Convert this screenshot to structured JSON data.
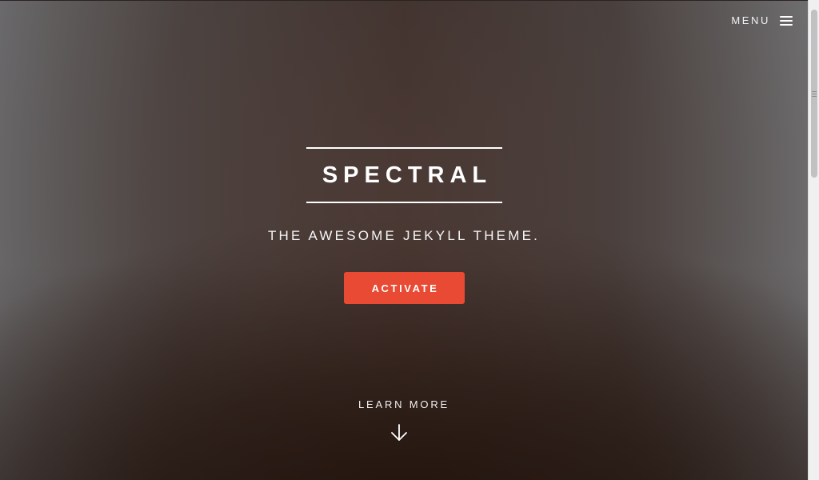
{
  "header": {
    "menu_label": "MENU",
    "menu_icon": "hamburger-icon"
  },
  "banner": {
    "title": "SPECTRAL",
    "subtitle": "THE AWESOME JEKYLL THEME.",
    "activate_label": "ACTIVATE",
    "learn_more_label": "LEARN MORE",
    "scroll_icon": "arrow-down-icon"
  },
  "colors": {
    "accent": "#e84a33",
    "text": "#ffffff"
  }
}
